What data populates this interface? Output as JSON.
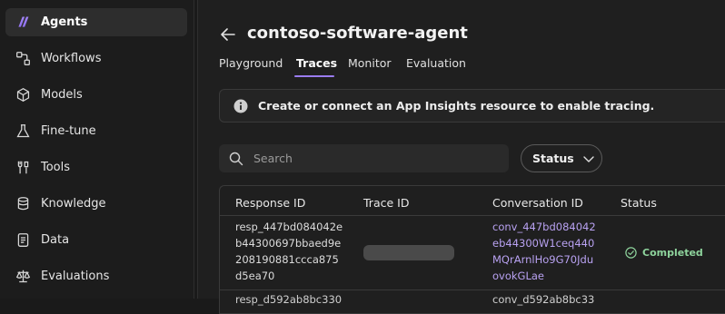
{
  "sidebar": {
    "items": [
      {
        "label": "Agents",
        "icon": "agents-logo-icon"
      },
      {
        "label": "Workflows",
        "icon": "workflows-icon"
      },
      {
        "label": "Models",
        "icon": "models-icon"
      },
      {
        "label": "Fine-tune",
        "icon": "flask-icon"
      },
      {
        "label": "Tools",
        "icon": "tools-icon"
      },
      {
        "label": "Knowledge",
        "icon": "database-icon"
      },
      {
        "label": "Data",
        "icon": "document-icon"
      },
      {
        "label": "Evaluations",
        "icon": "scale-icon"
      }
    ]
  },
  "header": {
    "title": "contoso-software-agent"
  },
  "tabs": [
    {
      "label": "Playground"
    },
    {
      "label": "Traces"
    },
    {
      "label": "Monitor"
    },
    {
      "label": "Evaluation"
    }
  ],
  "banner": {
    "text": "Create or connect an App Insights resource to enable tracing."
  },
  "search": {
    "placeholder": "Search"
  },
  "filter": {
    "status_label": "Status"
  },
  "table": {
    "columns": [
      "Response ID",
      "Trace ID",
      "Conversation ID",
      "Status"
    ],
    "rows": [
      {
        "response_id_lines": [
          "resp_447bd084042e",
          "b44300697bbaed9e",
          "208190881ccca875",
          "d5ea70"
        ],
        "conversation_id_lines": [
          "conv_447bd084042",
          "eb44300W1ceq440",
          "MQrArnlHo9G70Jdu",
          "ovokGLae"
        ],
        "status": "Completed"
      }
    ],
    "partial_row": {
      "response_id": "resp_d592ab8bc330",
      "conversation_id": "conv_d592ab8bc33"
    }
  },
  "colors": {
    "accent": "#9a7cf0",
    "link": "#b9a2f2",
    "success": "#8ed39c"
  }
}
